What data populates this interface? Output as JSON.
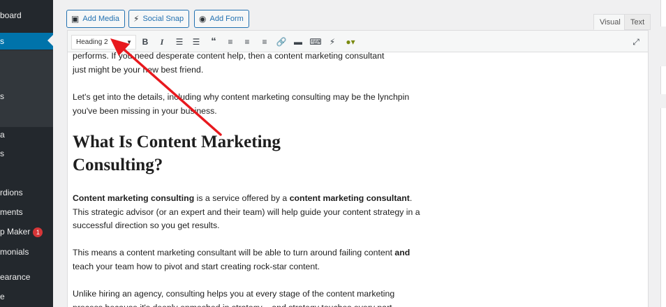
{
  "sidebar": {
    "items": [
      {
        "label": "board",
        "active": false
      },
      {
        "label": "s",
        "active": true
      },
      {
        "label": "",
        "active": false
      },
      {
        "label": "s",
        "active": false
      },
      {
        "label": "a",
        "active": false
      },
      {
        "label": "s",
        "active": false
      },
      {
        "label": "rdions",
        "active": false
      },
      {
        "label": "ments",
        "active": false
      },
      {
        "label": "p Maker",
        "active": false,
        "badge": "1"
      },
      {
        "label": "monials",
        "active": false
      },
      {
        "label": "earance",
        "active": false
      },
      {
        "label": "e",
        "active": false
      }
    ]
  },
  "media_buttons": [
    {
      "label": "Add Media",
      "icon": "media-icon"
    },
    {
      "label": "Social Snap",
      "icon": "social-snap-icon"
    },
    {
      "label": "Add Form",
      "icon": "form-icon"
    }
  ],
  "tabs": {
    "visual": "Visual",
    "text": "Text"
  },
  "toolbar": {
    "format_value": "Heading 2",
    "buttons": [
      "bold-icon",
      "italic-icon",
      "bullet-list-icon",
      "numbered-list-icon",
      "blockquote-icon",
      "align-left-icon",
      "align-center-icon",
      "align-right-icon",
      "link-icon",
      "read-more-icon",
      "toolbar-toggle-icon",
      "social-snap-icon",
      "plugin-dropdown-icon",
      "fullscreen-icon"
    ]
  },
  "content": {
    "p_intro_line1": "performs. If you need desperate content help, then a content marketing consultant",
    "p_intro_line2": "just might be your new best friend.",
    "p_details": "Let's get into the details, including why content marketing consulting may be the lynchpin you've been missing in your business.",
    "heading": "What Is Content Marketing Consulting?",
    "p_def_b1": "Content marketing consulting",
    "p_def_t1": " is a service offered by a ",
    "p_def_b2": "content marketing consultant",
    "p_def_t2": ". This strategic advisor (or an expert and their team) will help guide your content strategy in a successful direction so you get results.",
    "p_means_t1": "This means a content marketing consultant will be able to turn around failing content ",
    "p_means_b1": "and",
    "p_means_t2": " teach your team how to pivot and start creating rock-star content.",
    "p_unlike_line1": "Unlike hiring an agency, consulting helps you at every stage of the content marketing",
    "p_unlike_line2": "process because it's deeply enmeshed in strategy – and strategy touches every part"
  },
  "colors": {
    "sidebar_bg": "#23282d",
    "active_menu": "#0073aa",
    "button_blue": "#2271b1",
    "annotation_arrow": "#e8191e",
    "badge": "#d63638"
  }
}
